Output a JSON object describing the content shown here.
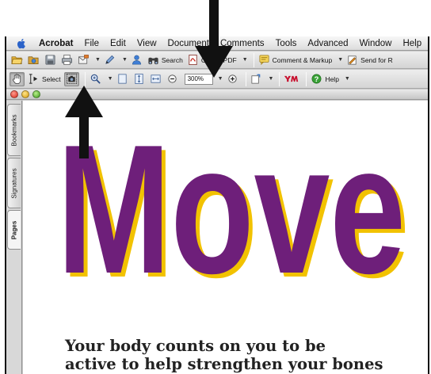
{
  "menubar": {
    "items": [
      "Acrobat",
      "File",
      "Edit",
      "View",
      "Document",
      "Comments",
      "Tools",
      "Advanced",
      "Window",
      "Help"
    ]
  },
  "toolbar1": {
    "search_label": "Search",
    "create_pdf_label": "Create PDF",
    "comment_markup_label": "Comment & Markup",
    "send_label": "Send for R"
  },
  "toolbar2": {
    "select_label": "Select",
    "zoom_value": "300%",
    "help_label": "Help"
  },
  "sidebar": {
    "tabs": [
      "Bookmarks",
      "Signatures",
      "Pages"
    ]
  },
  "document": {
    "headline": "Move",
    "body_line1": "Your body counts on you to be",
    "body_line2": "active to help strengthen your bones"
  },
  "colors": {
    "headline_fill": "#6e1f7a",
    "headline_shadow": "#f2c200",
    "arrow": "#111111",
    "body_text": "#222222"
  }
}
